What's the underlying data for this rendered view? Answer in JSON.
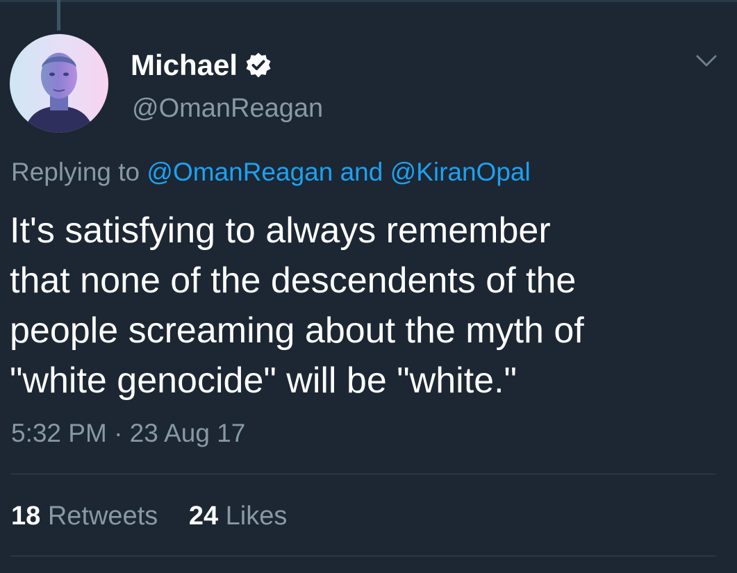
{
  "author": {
    "display_name": "Michael",
    "handle": "@OmanReagan",
    "verified": true
  },
  "reply": {
    "prefix": "Replying to",
    "mention_1": "@OmanReagan",
    "conjunction": "and",
    "mention_2": "@KiranOpal"
  },
  "tweet": {
    "lines": [
      "It's satisfying to always remember",
      "that none of the descendents of the",
      "people screaming about the myth of",
      "\"white genocide\" will be \"white.\""
    ],
    "timestamp": "5:32 PM · 23 Aug 17"
  },
  "stats": {
    "retweets_count": "18",
    "retweets_label": "Retweets",
    "likes_count": "24",
    "likes_label": "Likes"
  },
  "colors": {
    "background": "#1c2733",
    "text": "#ffffff",
    "muted": "#8899a6",
    "link": "#1da1f2",
    "divider": "#38444d"
  },
  "icons": {
    "verified": "verified-badge-icon",
    "menu": "chevron-down-icon"
  }
}
